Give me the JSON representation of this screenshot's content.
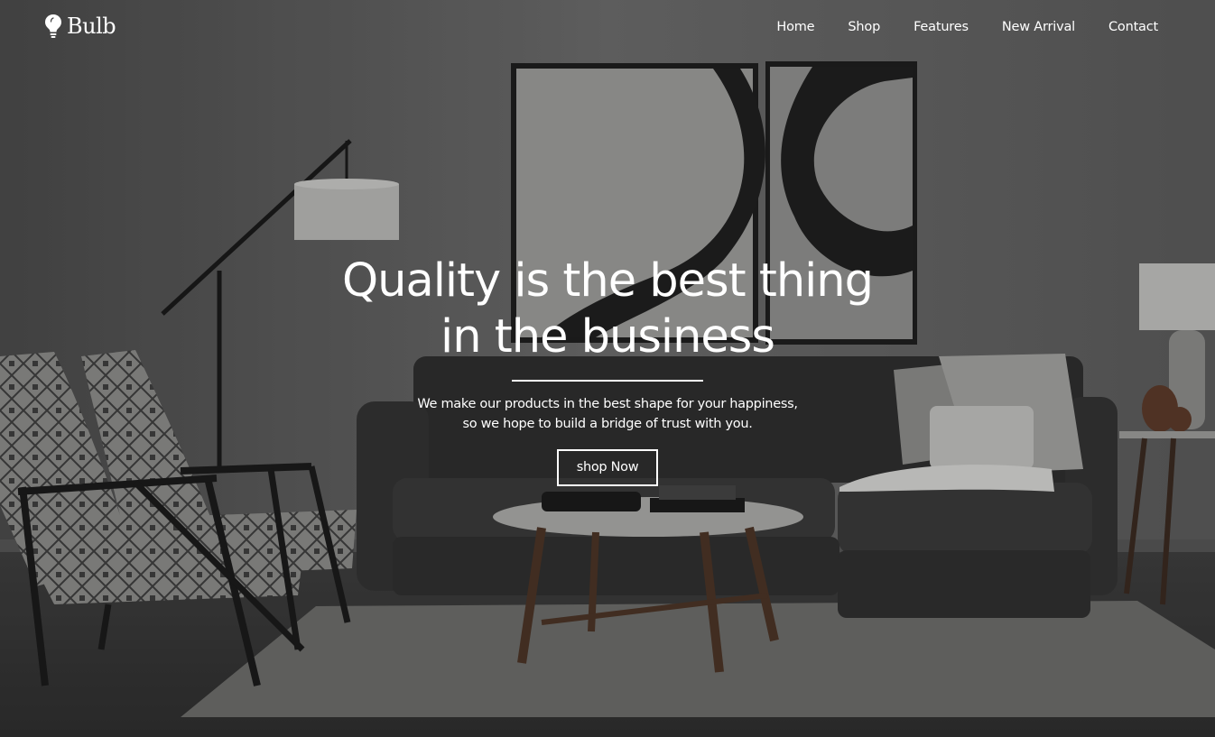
{
  "brand": {
    "name": "Bulb",
    "icon": "lightbulb-icon"
  },
  "nav": {
    "items": [
      {
        "label": "Home"
      },
      {
        "label": "Shop"
      },
      {
        "label": "Features"
      },
      {
        "label": "New Arrival"
      },
      {
        "label": "Contact"
      }
    ]
  },
  "hero": {
    "headline_line1": "Quality is the best thing",
    "headline_line2": "in the business",
    "subtext_line1": "We make our products in the best shape for your happiness,",
    "subtext_line2": "so we hope to build a bridge of trust with you.",
    "cta_label": "shop Now",
    "background": "living-room-photo"
  },
  "colors": {
    "text": "#ffffff",
    "overlay": "#000000"
  }
}
